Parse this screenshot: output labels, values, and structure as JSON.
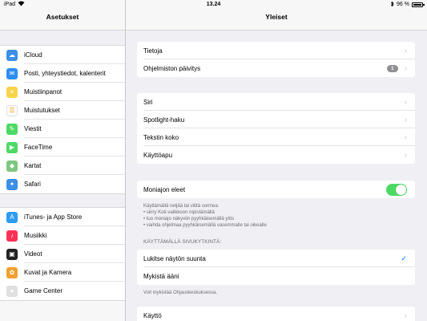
{
  "status": {
    "device": "iPad",
    "wifi_icon": "wifi-icon",
    "time": "13.24",
    "bluetooth_icon": "bluetooth-icon",
    "battery": "96 %"
  },
  "sidebar": {
    "title": "Asetukset",
    "groups": [
      [
        {
          "label": "iCloud",
          "icon": "cloud-icon",
          "color": "#3b8fe6",
          "glyph": "☁"
        },
        {
          "label": "Posti, yhteystiedot, kalenterit",
          "icon": "mail-icon",
          "color": "#2b8ef0",
          "glyph": "✉"
        },
        {
          "label": "Muistiinpanot",
          "icon": "notes-icon",
          "color": "#f7d44a",
          "glyph": "≡"
        },
        {
          "label": "Muistutukset",
          "icon": "reminders-icon",
          "color": "#ffffff",
          "glyph": "☰"
        },
        {
          "label": "Viestit",
          "icon": "messages-icon",
          "color": "#4cd964",
          "glyph": "✎"
        },
        {
          "label": "FaceTime",
          "icon": "facetime-icon",
          "color": "#4cd964",
          "glyph": "▶"
        },
        {
          "label": "Kartat",
          "icon": "maps-icon",
          "color": "#7fc77f",
          "glyph": "◆"
        },
        {
          "label": "Safari",
          "icon": "safari-icon",
          "color": "#3b8fe6",
          "glyph": "✦"
        }
      ],
      [
        {
          "label": "iTunes- ja App Store",
          "icon": "app-store-icon",
          "color": "#2d9cf0",
          "glyph": "A"
        },
        {
          "label": "Musiikki",
          "icon": "music-icon",
          "color": "#fc3158",
          "glyph": "♪"
        },
        {
          "label": "Videot",
          "icon": "videos-icon",
          "color": "#222222",
          "glyph": "▣"
        },
        {
          "label": "Kuvat ja Kamera",
          "icon": "photos-icon",
          "color": "#f0a030",
          "glyph": "✿"
        },
        {
          "label": "Game Center",
          "icon": "game-center-icon",
          "color": "#e0e0e0",
          "glyph": "●"
        }
      ]
    ]
  },
  "main": {
    "title": "Yleiset",
    "group1": [
      {
        "label": "Tietoja"
      },
      {
        "label": "Ohjelmiston päivitys",
        "badge": "1"
      }
    ],
    "group2": [
      {
        "label": "Siri"
      },
      {
        "label": "Spotlight-haku"
      },
      {
        "label": "Tekstin koko"
      },
      {
        "label": "Käyttöapu"
      }
    ],
    "multitask": {
      "label": "Moniajon eleet",
      "on": true
    },
    "multitask_note": [
      "Käyttämällä neljää tai viittä sormea:",
      "• siirry Koti-valikkoon nipistämällä",
      "• tuo moniajo näkyviin pyyhkäisemällä ylös",
      "• vaihda ohjelmaa pyyhkäisemällä vasemmalle tai oikealle"
    ],
    "side_switch_header": "KÄYTTÄMÄLLÄ SIVUKYTKINTÄ:",
    "side_switch": [
      {
        "label": "Lukitse näytön suunta",
        "checked": true
      },
      {
        "label": "Mykistä ääni",
        "checked": false
      }
    ],
    "side_switch_note": "Voit mykistää Ohjauskeskuksessa.",
    "group4": [
      {
        "label": "Käyttö"
      }
    ]
  }
}
